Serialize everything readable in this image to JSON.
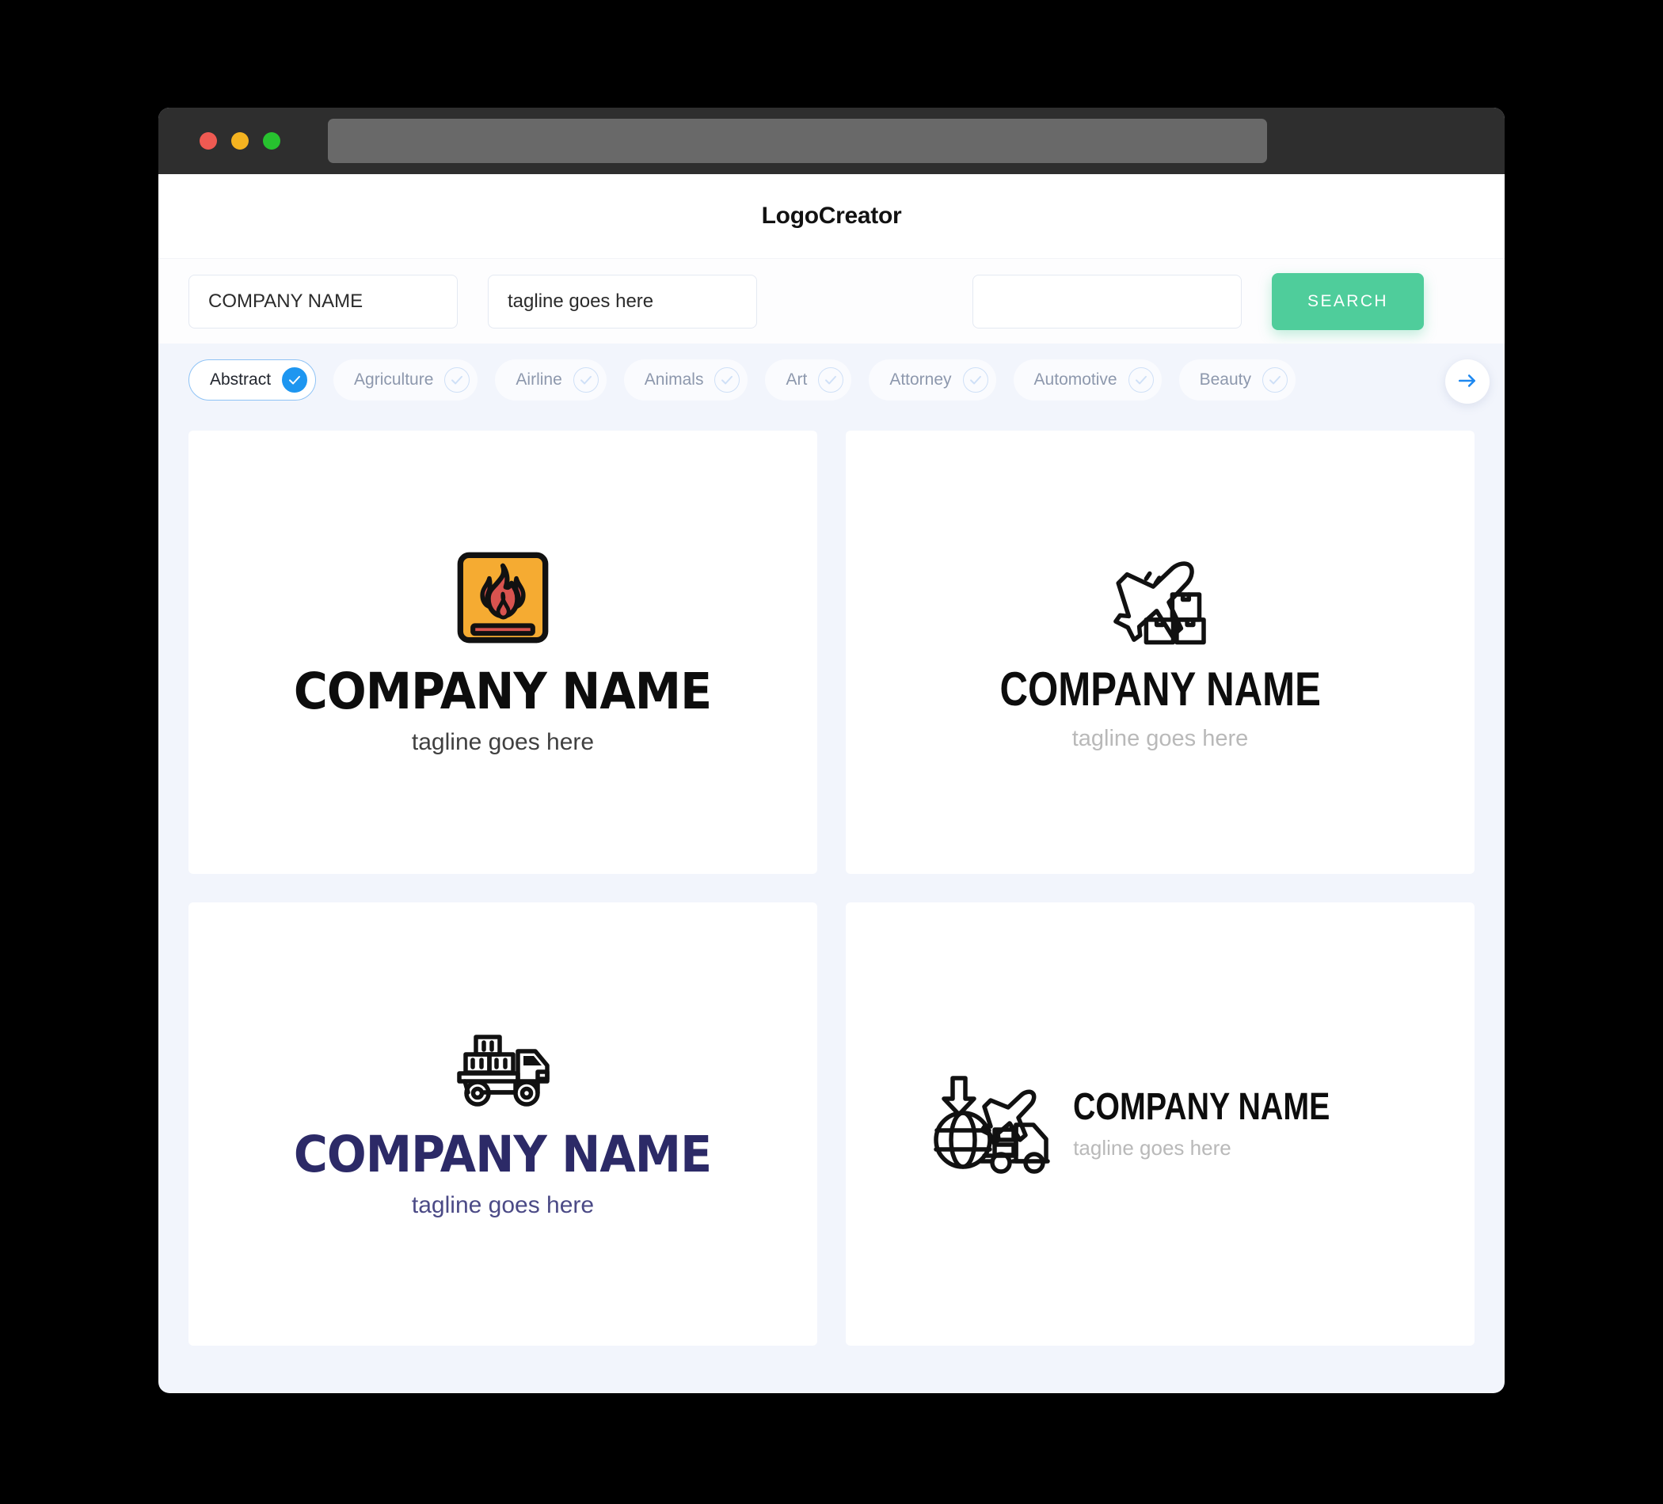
{
  "window": {
    "traffic_lights": [
      {
        "name": "close",
        "color": "#ef5a52"
      },
      {
        "name": "minimize",
        "color": "#f4b320"
      },
      {
        "name": "maximize",
        "color": "#27c22f"
      }
    ],
    "url_value": ""
  },
  "header": {
    "app_title": "LogoCreator"
  },
  "search": {
    "company_value": "COMPANY NAME",
    "company_placeholder": "COMPANY NAME",
    "tagline_value": "tagline goes here",
    "tagline_placeholder": "tagline goes here",
    "extra_value": "",
    "extra_placeholder": "",
    "button_label": "SEARCH",
    "button_color": "#4fcd9b"
  },
  "categories": {
    "accent_color": "#1e96f0",
    "next_icon": "arrow-right-icon",
    "items": [
      {
        "label": "Abstract",
        "selected": true
      },
      {
        "label": "Agriculture",
        "selected": false
      },
      {
        "label": "Airline",
        "selected": false
      },
      {
        "label": "Animals",
        "selected": false
      },
      {
        "label": "Art",
        "selected": false
      },
      {
        "label": "Attorney",
        "selected": false
      },
      {
        "label": "Automotive",
        "selected": false
      },
      {
        "label": "Beauty",
        "selected": false
      }
    ]
  },
  "results": {
    "cards": [
      {
        "icon": "fire-flame-badge-icon",
        "title": "COMPANY NAME",
        "tagline": "tagline goes here",
        "title_color": "#0d0d0d",
        "tagline_color": "#404040",
        "icon_colors": {
          "badge": "#f5ab32",
          "flame": "#d9534f",
          "outline": "#111111"
        },
        "layout": "stacked"
      },
      {
        "icon": "airplane-cargo-boxes-icon",
        "title": "COMPANY NAME",
        "tagline": "tagline goes here",
        "title_color": "#0d0d0d",
        "tagline_color": "#b9b9b9",
        "icon_colors": {
          "outline": "#111111"
        },
        "layout": "stacked"
      },
      {
        "icon": "flatbed-truck-crates-icon",
        "title": "COMPANY NAME",
        "tagline": "tagline goes here",
        "title_color": "#2c2a67",
        "tagline_color": "#4b4a86",
        "icon_colors": {
          "outline": "#111111"
        },
        "layout": "stacked"
      },
      {
        "icon": "globe-plane-truck-logistics-icon",
        "title": "COMPANY NAME",
        "tagline": "tagline goes here",
        "title_color": "#0d0d0d",
        "tagline_color": "#b9b9b9",
        "icon_colors": {
          "outline": "#111111"
        },
        "layout": "horizontal"
      }
    ]
  }
}
